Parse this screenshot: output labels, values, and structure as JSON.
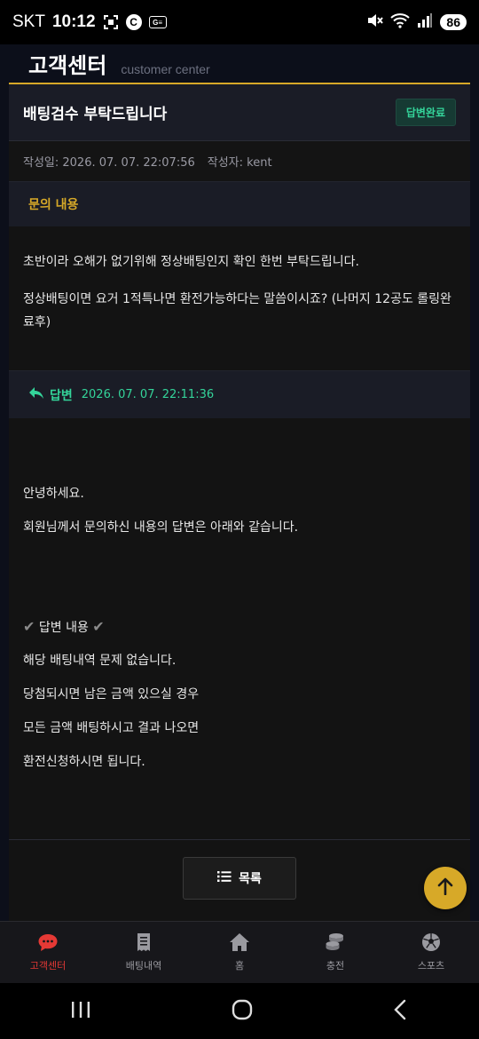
{
  "status_bar": {
    "carrier": "SKT",
    "time": "10:12",
    "battery": "86",
    "signal_sup": "6"
  },
  "header": {
    "title": "고객센터",
    "subtitle": "customer center"
  },
  "inquiry": {
    "title": "배팅검수 부탁드립니다",
    "badge": "답변완료",
    "date_label": "작성일: 2026. 07. 07. 22:07:56",
    "author_label": "작성자: kent",
    "section_label": "문의 내용",
    "body": [
      "초반이라 오해가 없기위해 정상배팅인지 확인 한번 부탁드립니다.",
      "정상배팅이면 요거 1적특나면 환전가능하다는 말씀이시죠? (나머지 12공도 롤링완료후)"
    ]
  },
  "answer": {
    "label": "답변",
    "date": "2026. 07. 07. 22:11:36",
    "greeting": "안녕하세요.",
    "intro": "회원님께서 문의하신 내용의 답변은 아래와 같습니다.",
    "content_heading": "답변 내용",
    "lines": [
      "해당 배팅내역 문제 없습니다.",
      "당첨되시면 남은 금액 있으실 경우",
      "모든 금액 배팅하시고 결과 나오면",
      "환전신청하시면 됩니다."
    ]
  },
  "list_button": {
    "label": "목록"
  },
  "tabs": [
    {
      "label": "고객센터",
      "icon": "chat-icon",
      "active": true
    },
    {
      "label": "배팅내역",
      "icon": "receipt-icon"
    },
    {
      "label": "홈",
      "icon": "home-icon"
    },
    {
      "label": "충전",
      "icon": "coins-icon"
    },
    {
      "label": "스포츠",
      "icon": "soccer-ball-icon"
    }
  ],
  "colors": {
    "accent": "#d7a928",
    "answer_green": "#34d49a",
    "active_tab": "#e53935"
  }
}
